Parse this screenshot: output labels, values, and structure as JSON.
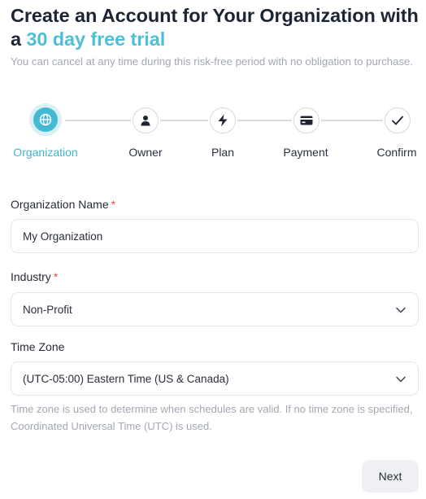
{
  "header": {
    "title_prefix": "Create an Account for Your Organization with a ",
    "title_accent": "30 day free trial",
    "subtitle": "You can cancel at any time during this risk-free period with no obligation to purchase."
  },
  "stepper": {
    "active_index": 0,
    "steps": [
      {
        "label": "Organization",
        "icon": "globe-icon"
      },
      {
        "label": "Owner",
        "icon": "user-icon"
      },
      {
        "label": "Plan",
        "icon": "lightning-icon"
      },
      {
        "label": "Payment",
        "icon": "credit-card-icon"
      },
      {
        "label": "Confirm",
        "icon": "check-icon"
      }
    ]
  },
  "form": {
    "org_name": {
      "label": "Organization Name",
      "required_mark": "*",
      "value": "My Organization"
    },
    "industry": {
      "label": "Industry",
      "required_mark": "*",
      "value": "Non-Profit"
    },
    "time_zone": {
      "label": "Time Zone",
      "value": "(UTC-05:00) Eastern Time (US & Canada)",
      "help": "Time zone is used to determine when schedules are valid. If no time zone is specified, Coordinated Universal Time (UTC) is used."
    }
  },
  "actions": {
    "next_label": "Next"
  },
  "colors": {
    "accent": "#44b9d2",
    "required": "#e44c3e",
    "muted": "#a3a8b3"
  }
}
